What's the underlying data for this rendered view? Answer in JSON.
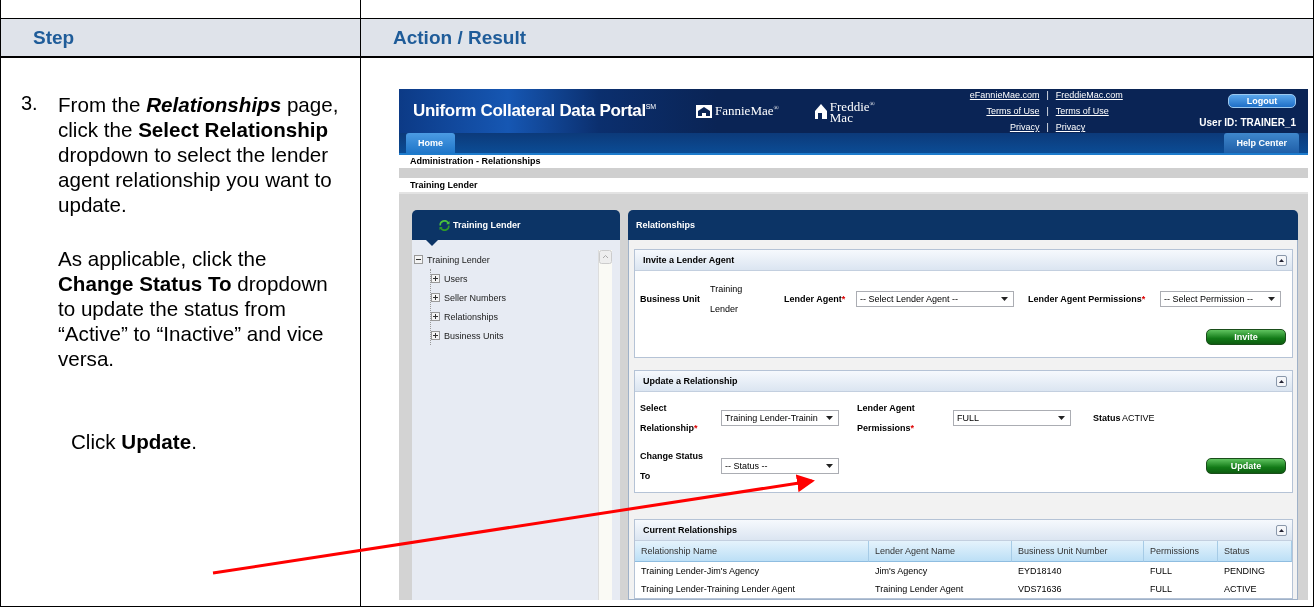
{
  "table": {
    "columns": [
      "Step",
      "Action / Result"
    ]
  },
  "step": {
    "number": "3.",
    "paragraphs": [
      "From the *Relationships* page, click the **Select Relationship** dropdown to select the lender agent relationship you want to update.",
      "As applicable, click the **Change Status To** dropdown to update the status from “Active” to “Inactive” and vice versa.",
      "Click **Update**."
    ]
  },
  "portal": {
    "header": {
      "title": "Uniform Collateral Data Portal",
      "title_mark": "SM",
      "fannie_logo": "FannieMae",
      "fannie_mark": "®",
      "freddie_logo": [
        "Freddie",
        "Mac"
      ],
      "freddie_mark": "®",
      "separator": "|",
      "links": [
        [
          "eFannieMae.com",
          "FreddieMac.com"
        ],
        [
          "Terms of Use",
          "Terms of Use"
        ],
        [
          "Privacy",
          "Privacy"
        ]
      ],
      "logout": "Logout",
      "user": "User ID: TRAINER_1"
    },
    "nav": [
      {
        "label": "Home",
        "selected": true
      },
      {
        "label": "Help Center",
        "selected": false
      }
    ],
    "breadcrumb": "Administration - Relationships",
    "page_title": "Training Lender",
    "sidebar": {
      "title": "Training Lender",
      "tree": [
        {
          "label": "Training Lender",
          "expanded": true,
          "children": [
            {
              "label": "Users",
              "expanded": false
            },
            {
              "label": "Seller Numbers",
              "expanded": false
            },
            {
              "label": "Relationships",
              "expanded": false
            },
            {
              "label": "Business Units",
              "expanded": false
            }
          ]
        }
      ]
    },
    "main": {
      "title": "Relationships",
      "invite": {
        "title": "Invite a Lender Agent",
        "business_unit_label": "Business Unit",
        "business_unit": "Training Lender",
        "agent_label": "Lender Agent",
        "agent_required": "*",
        "agent_select": "-- Select Lender Agent --",
        "permissions_label": "Lender Agent Permissions",
        "permissions_required": "*",
        "permissions_select": "-- Select Permission --",
        "button": "Invite"
      },
      "update": {
        "title": "Update a Relationship",
        "relationship_label": "Select Relationship",
        "relationship_required": "*",
        "relationship_select": "Training Lender-Trainin",
        "permissions_label": "Lender Agent Permissions",
        "permissions_required": "*",
        "permissions_select": "FULL",
        "status_label": "Status",
        "status": "ACTIVE",
        "change_label": "Change Status To",
        "change_select": "-- Status --",
        "button": "Update"
      },
      "current": {
        "title": "Current Relationships",
        "columns": [
          "Relationship Name",
          "Lender Agent Name",
          "Business Unit Number",
          "Permissions",
          "Status"
        ],
        "rows": [
          [
            "Training Lender-Jim's Agency",
            "Jim's Agency",
            "EYD18140",
            "FULL",
            "PENDING"
          ],
          [
            "Training Lender-Training Lender Agent",
            "Training Lender Agent",
            "VDS71636",
            "FULL",
            "ACTIVE"
          ]
        ]
      }
    }
  }
}
